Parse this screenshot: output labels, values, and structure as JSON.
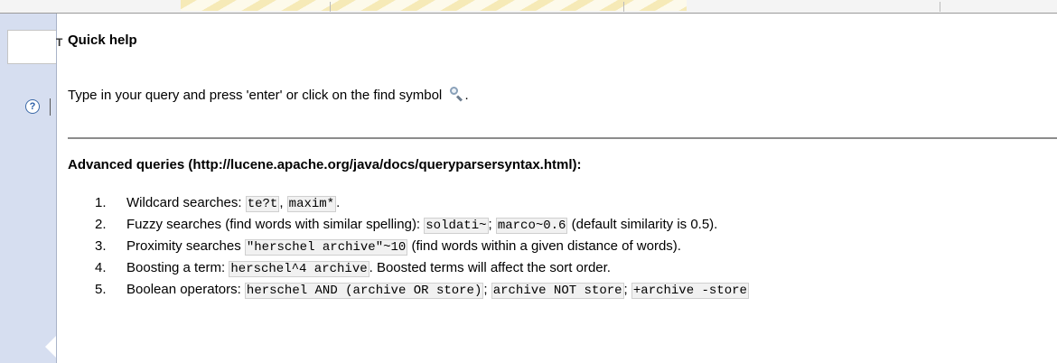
{
  "panel": {
    "tab_letter": "T",
    "help_icon_glyph": "?",
    "help_icon": "help-circle-icon"
  },
  "quick_help": {
    "title": "Quick help",
    "intro_text": "Type in your query and press 'enter' or click on the find symbol",
    "intro_end": ".",
    "search_icon": "magnifier-icon",
    "advanced_title": "Advanced queries (http://lucene.apache.org/java/docs/queryparsersyntax.html):",
    "items": [
      {
        "num": "1.",
        "parts": [
          {
            "t": "Wildcard searches: "
          },
          {
            "c": "te?t"
          },
          {
            "t": ", "
          },
          {
            "c": "maxim*"
          },
          {
            "t": "."
          }
        ]
      },
      {
        "num": "2.",
        "parts": [
          {
            "t": "Fuzzy searches (find words with similar spelling): "
          },
          {
            "c": "soldati~"
          },
          {
            "t": "; "
          },
          {
            "c": "marco~0.6"
          },
          {
            "t": " (default similarity is 0.5)."
          }
        ]
      },
      {
        "num": "3.",
        "parts": [
          {
            "t": "Proximity searches "
          },
          {
            "c": "\"herschel archive\"~10"
          },
          {
            "t": " (find words within a given distance of words)."
          }
        ]
      },
      {
        "num": "4.",
        "parts": [
          {
            "t": "Boosting a term: "
          },
          {
            "c": "herschel^4 archive"
          },
          {
            "t": ". Boosted terms will affect the sort order."
          }
        ]
      },
      {
        "num": "5.",
        "parts": [
          {
            "t": "Boolean operators: "
          },
          {
            "c": "herschel AND (archive OR store)"
          },
          {
            "t": "; "
          },
          {
            "c": "archive NOT store"
          },
          {
            "t": "; "
          },
          {
            "c": "+archive -store"
          }
        ]
      }
    ]
  }
}
